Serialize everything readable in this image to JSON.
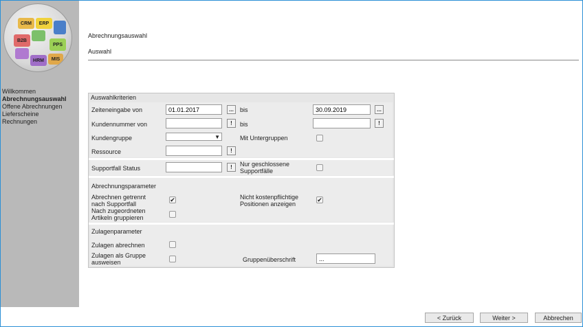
{
  "nav": {
    "items": [
      {
        "label": "Willkommen",
        "active": false
      },
      {
        "label": "Abrechnungsauswahl",
        "active": true
      },
      {
        "label": "Offene Abrechnungen",
        "active": false
      },
      {
        "label": "Lieferscheine",
        "active": false
      },
      {
        "label": "Rechnungen",
        "active": false
      }
    ]
  },
  "logo": {
    "pieces": [
      "CRM",
      "ERP",
      "B2B",
      "PPS",
      "HRM",
      "MIS"
    ]
  },
  "header": {
    "title": "Abrechnungsauswahl",
    "subtitle": "Auswahl"
  },
  "criteria": {
    "title": "Auswahlkriterien",
    "zeiteneingabe": {
      "label": "Zeiteneingabe von",
      "from": "01.01.2017",
      "bis_label": "bis",
      "to": "30.09.2019",
      "btn": "..."
    },
    "kundennummer": {
      "label": "Kundennummer von",
      "from": "",
      "bis_label": "bis",
      "to": "",
      "btn": "!"
    },
    "kundengruppe": {
      "label": "Kundengruppe",
      "value": "",
      "arrow": "▼"
    },
    "untergruppen": {
      "label": "Mit Untergruppen",
      "checked": false
    },
    "ressource": {
      "label": "Ressource",
      "value": "",
      "btn": "!"
    },
    "supportfall": {
      "label": "Supportfall Status",
      "value": "",
      "btn": "!"
    },
    "geschlossen": {
      "label_line1": "Nur geschlossene",
      "label_line2": "Supportfälle",
      "checked": false
    }
  },
  "billing": {
    "title": "Abrechnungsparameter",
    "getrennt": {
      "label_line1": "Abrechnen getrennt",
      "label_line2": "nach Supportfall",
      "checked": true,
      "mark": "✔"
    },
    "kostenpflichtig": {
      "label_line1": "Nicht kostenpflichtige",
      "label_line2": "Positionen anzeigen",
      "checked": true,
      "mark": "✔"
    },
    "gruppieren": {
      "label_line1": "Nach zugeordneten",
      "label_line2": "Artikeln gruppieren",
      "checked": false
    }
  },
  "supplements": {
    "title": "Zulagenparameter",
    "abrechnen": {
      "label": "Zulagen abrechnen",
      "checked": false
    },
    "gruppe": {
      "label_line1": "Zulagen als Gruppe",
      "label_line2": "ausweisen",
      "checked": false
    },
    "ueberschrift": {
      "label": "Gruppenüberschrift",
      "value": "..."
    }
  },
  "footer": {
    "back": "< Zurück",
    "next": "Weiter >",
    "cancel": "Abbrechen"
  },
  "colors": {
    "sidebar": "#b9b9b9",
    "panel": "#e6e6e6",
    "frame": "#2a8fd6"
  }
}
